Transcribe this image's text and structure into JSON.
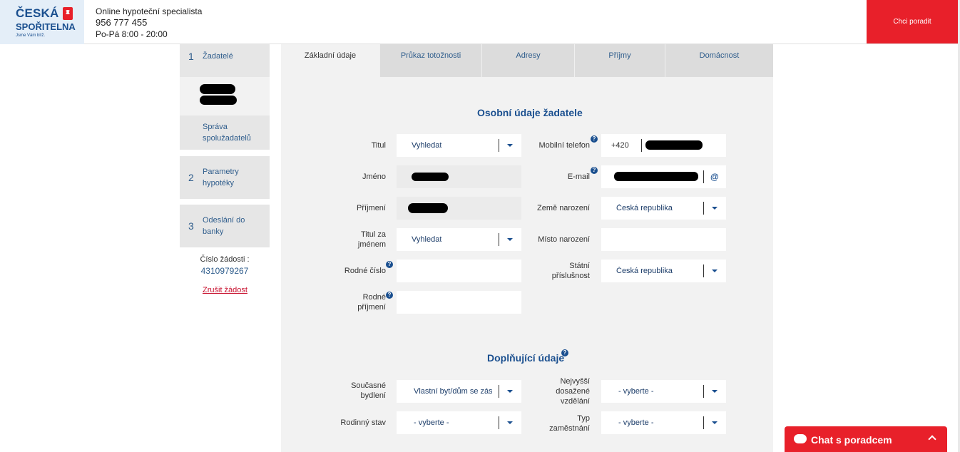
{
  "header": {
    "logo_line1": "ČESKÁ",
    "logo_line2": "SPOŘITELNA",
    "logo_tagline": "Jsme Vám blíž.",
    "specialist_label": "Online hypoteční specialista",
    "phone": "956 777 455",
    "hours": "Po-Pá 8:00 - 20:00",
    "cta_label": "Chci poradit"
  },
  "sidebar": {
    "steps": [
      {
        "num": "1",
        "label": "Žadatelé"
      },
      {
        "num": "2",
        "label": "Parametry hypotéky"
      },
      {
        "num": "3",
        "label": "Odeslání do banky"
      }
    ],
    "manage_label": "Správa spolužadatelů",
    "request_label": "Číslo žádosti :",
    "request_number": "4310979267",
    "cancel_label": "Zrušit žádost"
  },
  "tabs": [
    "Základní údaje",
    "Průkaz totožnosti",
    "Adresy",
    "Příjmy",
    "Domácnost"
  ],
  "personal": {
    "title": "Osobní údaje žadatele",
    "titul_label": "Titul",
    "titul_value": "Vyhledat",
    "jmeno_label": "Jméno",
    "prijmeni_label": "Příjmení",
    "titul_za_label": "Titul za jménem",
    "titul_za_value": "Vyhledat",
    "rodne_cislo_label": "Rodné číslo",
    "rodne_prijmeni_label": "Rodné příjmení",
    "mobil_label": "Mobilní telefon",
    "mobil_prefix": "+420",
    "email_label": "E-mail",
    "email_icon": "@",
    "zeme_label": "Země narození",
    "zeme_value": "Česká republika",
    "misto_label": "Místo narození",
    "statni_label": "Státní příslušnost",
    "statni_value": "Česká republika"
  },
  "extra": {
    "title": "Doplňující údaje",
    "bydleni_label": "Současné bydlení",
    "bydleni_value": "Vlastní byt/dům se zás",
    "vzdelani_label": "Nejvyšší dosažené vzdělání",
    "vzdelani_value": "- vyberte -",
    "stav_label": "Rodinný stav",
    "stav_value": "- vyberte -",
    "zamestnani_label": "Typ zaměstnání",
    "zamestnani_value": "- vyberte -"
  },
  "chat": {
    "label": "Chat s poradcem"
  },
  "help_glyph": "?",
  "colors": {
    "brand_blue": "#1a4f8f",
    "brand_red": "#e8202a"
  }
}
